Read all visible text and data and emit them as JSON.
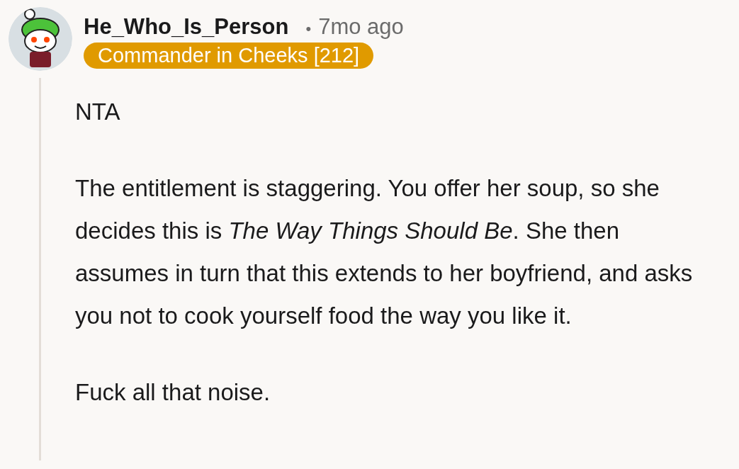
{
  "comment": {
    "author": "He_Who_Is_Person",
    "separator": "•",
    "time": "7mo ago",
    "flair": {
      "text": "Commander in Cheeks [212]",
      "color": "#e09a00"
    },
    "paragraphs": [
      "NTA",
      "The entitlement is staggering. You offer her soup, so she decides this is *The Way Things Should Be*. She then assumes in turn that this extends to her boyfriend, and asks you not to cook yourself food the way you like it.",
      "Fuck all that noise."
    ]
  }
}
